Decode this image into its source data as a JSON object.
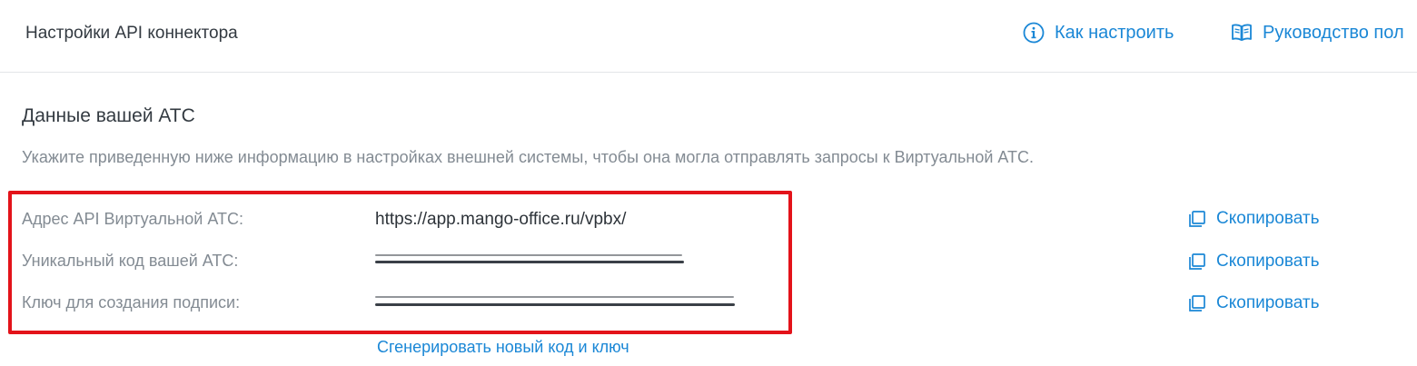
{
  "header": {
    "title": "Настройки API коннектора",
    "how_to_label": "Как настроить",
    "how_to_icon": "info-icon",
    "guide_label": "Руководство пол",
    "guide_icon": "book-icon"
  },
  "section": {
    "title": "Данные вашей АТС",
    "description": "Укажите приведенную ниже информацию в настройках внешней системы, чтобы она могла отправлять запросы к Виртуальной АТС."
  },
  "fields": [
    {
      "label": "Адрес API Виртуальной АТС:",
      "value": "https://app.mango-office.ru/vpbx/",
      "masked": false,
      "copy_label": "Скопировать"
    },
    {
      "label": "Уникальный код вашей АТС:",
      "value": "",
      "masked": true,
      "copy_label": "Скопировать"
    },
    {
      "label": "Ключ для создания подписи:",
      "value": "",
      "masked": true,
      "copy_label": "Скопировать"
    }
  ],
  "generate_label": "Сгенерировать новый код и ключ",
  "colors": {
    "accent": "#1a87d6",
    "highlight": "#e3131a",
    "label": "#838b93",
    "text": "#2d3339"
  }
}
